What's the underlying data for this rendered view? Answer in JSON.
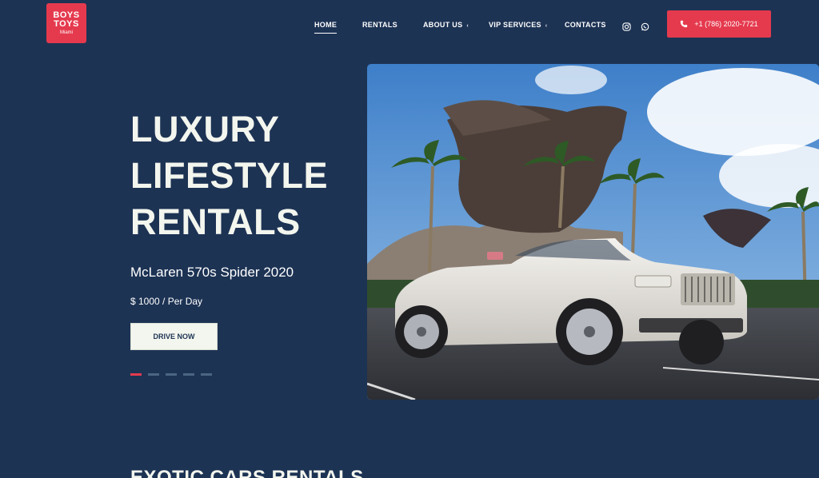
{
  "logo": {
    "line1": "BOYS",
    "line2": "TOYS",
    "line3": "Miami"
  },
  "nav": {
    "home": "HOME",
    "rentals": "RENTALS",
    "about": "ABOUT US",
    "vip": "VIP SERVICES",
    "contacts": "CONTACTS"
  },
  "social": {
    "instagram": "instagram-icon",
    "whatsapp": "whatsapp-icon"
  },
  "phone": {
    "label": "+1 (786) 2020-7721",
    "icon": "phone-icon"
  },
  "hero": {
    "title_line1": "LUXURY",
    "title_line2": "LIFESTYLE",
    "title_line3": "RENTALS",
    "car_name": "McLaren 570s Spider 2020",
    "price": "$ 1000 / Per Day",
    "cta": "DRIVE NOW",
    "slides": 5,
    "active_slide": 1
  },
  "section": {
    "title": "EXOTIC CARS RENTALS"
  },
  "colors": {
    "background": "#1d3354",
    "accent": "#e53a4e",
    "light": "#f3f6ee"
  }
}
